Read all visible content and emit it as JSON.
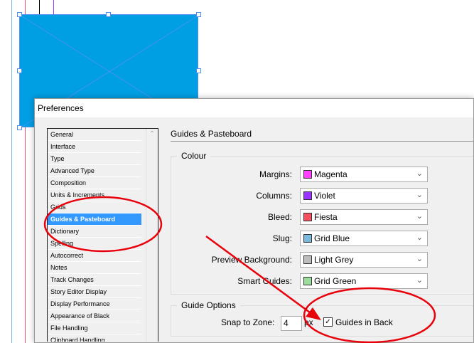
{
  "dialog": {
    "title": "Preferences"
  },
  "sidebar": {
    "items": [
      {
        "label": "General"
      },
      {
        "label": "Interface"
      },
      {
        "label": "Type"
      },
      {
        "label": "Advanced Type"
      },
      {
        "label": "Composition"
      },
      {
        "label": "Units & Increments"
      },
      {
        "label": "Grids"
      },
      {
        "label": "Guides & Pasteboard",
        "selected": true
      },
      {
        "label": "Dictionary"
      },
      {
        "label": "Spelling"
      },
      {
        "label": "Autocorrect"
      },
      {
        "label": "Notes"
      },
      {
        "label": "Track Changes"
      },
      {
        "label": "Story Editor Display"
      },
      {
        "label": "Display Performance"
      },
      {
        "label": "Appearance of Black"
      },
      {
        "label": "File Handling"
      },
      {
        "label": "Clipboard Handling"
      }
    ]
  },
  "panel": {
    "title": "Guides & Pasteboard",
    "colour": {
      "title": "Colour",
      "rows": [
        {
          "label": "Margins:",
          "value": "Magenta",
          "color": "#ff40ff"
        },
        {
          "label": "Columns:",
          "value": "Violet",
          "color": "#9933ff"
        },
        {
          "label": "Bleed:",
          "value": "Fiesta",
          "color": "#f4505f"
        },
        {
          "label": "Slug:",
          "value": "Grid Blue",
          "color": "#7ab8dc"
        },
        {
          "label": "Preview Background:",
          "value": "Light Grey",
          "color": "#bdbdbd"
        },
        {
          "label": "Smart Guides:",
          "value": "Grid Green",
          "color": "#9cdc9c"
        }
      ]
    },
    "guide_options": {
      "title": "Guide Options",
      "snap_label": "Snap to Zone:",
      "snap_value": "4",
      "unit": "px",
      "guides_in_back_label": "Guides in Back",
      "guides_in_back": true
    }
  },
  "colors": {
    "frame": "#009fe3",
    "annotation": "#e8000b",
    "selection": "#3399ff"
  }
}
